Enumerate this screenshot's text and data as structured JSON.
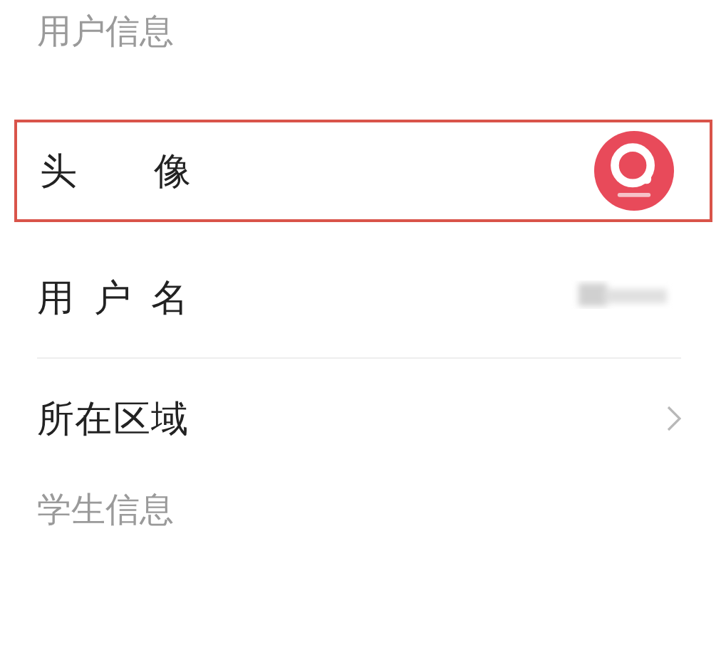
{
  "sections": [
    {
      "title": "用户信息",
      "rows": [
        {
          "kind": "avatar",
          "label": "头 像",
          "highlighted": true
        },
        {
          "kind": "blurred",
          "label": "用 户 名",
          "highlighted": false
        },
        {
          "kind": "link",
          "label": "所在区域",
          "highlighted": false
        }
      ]
    },
    {
      "title": "学生信息"
    }
  ]
}
